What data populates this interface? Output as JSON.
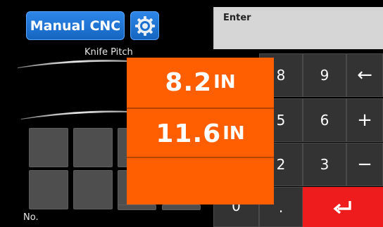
{
  "header": {
    "manual_label": "Manual CNC",
    "settings_icon": "gear-icon"
  },
  "left_panel": {
    "pitch_label": "Knife Pitch",
    "no_label": "No."
  },
  "keypad": {
    "enter_label": "Enter",
    "keys": [
      "8",
      "9",
      "5",
      "6",
      "2",
      "3",
      "0",
      "."
    ],
    "backspace_symbol": "←",
    "plus_symbol": "+",
    "minus_symbol": "−"
  },
  "popup": {
    "rows": [
      {
        "value": "8.2",
        "unit": "IN"
      },
      {
        "value": "11.6",
        "unit": "IN"
      },
      {
        "value": "",
        "unit": ""
      }
    ]
  },
  "colors": {
    "accent_blue": "#1e78dc",
    "popup_orange": "#ff5f00",
    "enter_red": "#ee1c1c"
  }
}
